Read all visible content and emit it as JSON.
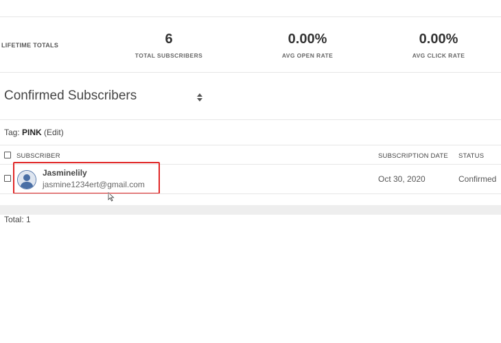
{
  "totals": {
    "label": "LIFETIME TOTALS",
    "stats": [
      {
        "value": "6",
        "label": "TOTAL SUBSCRIBERS"
      },
      {
        "value": "0.00%",
        "label": "AVG OPEN RATE"
      },
      {
        "value": "0.00%",
        "label": "AVG CLICK RATE"
      }
    ]
  },
  "list": {
    "title": "Confirmed Subscribers",
    "sort_icon": "sort-updown-icon"
  },
  "tag": {
    "prefix": "Tag: ",
    "name": "PINK",
    "edit": "(Edit)"
  },
  "table": {
    "columns": {
      "subscriber": "SUBSCRIBER",
      "date": "SUBSCRIPTION DATE",
      "status": "STATUS"
    },
    "rows": [
      {
        "name": "Jasminelily",
        "email": "jasmine1234ert@gmail.com",
        "date": "Oct 30, 2020",
        "status": "Confirmed",
        "avatar_icon": "user-avatar-icon"
      }
    ]
  },
  "footer": {
    "total": "Total: 1"
  },
  "colors": {
    "highlight": "#e02424",
    "avatar": "#4a6fa5"
  }
}
